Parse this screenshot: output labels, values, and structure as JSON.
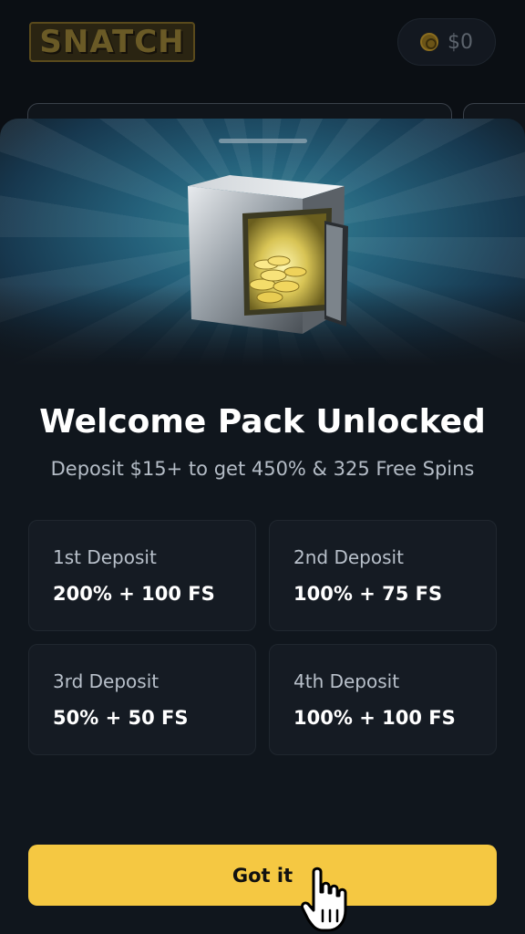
{
  "header": {
    "logo_text": "SNATCH",
    "balance": "$0",
    "balance_icon": "coin-icon"
  },
  "sheet": {
    "title": "Welcome Pack Unlocked",
    "subtitle": "Deposit $15+ to get 450% & 325 Free Spins",
    "hero_icon": "safe-with-coins-icon",
    "deposits": [
      {
        "label": "1st Deposit",
        "value": "200% + 100 FS"
      },
      {
        "label": "2nd Deposit",
        "value": "100% + 75 FS"
      },
      {
        "label": "3rd Deposit",
        "value": "50% + 50 FS"
      },
      {
        "label": "4th Deposit",
        "value": "100% + 100 FS"
      }
    ],
    "cta_label": "Got it"
  },
  "colors": {
    "accent": "#f5c842",
    "sheet_bg": "#10161d",
    "card_bg": "#151b23"
  }
}
